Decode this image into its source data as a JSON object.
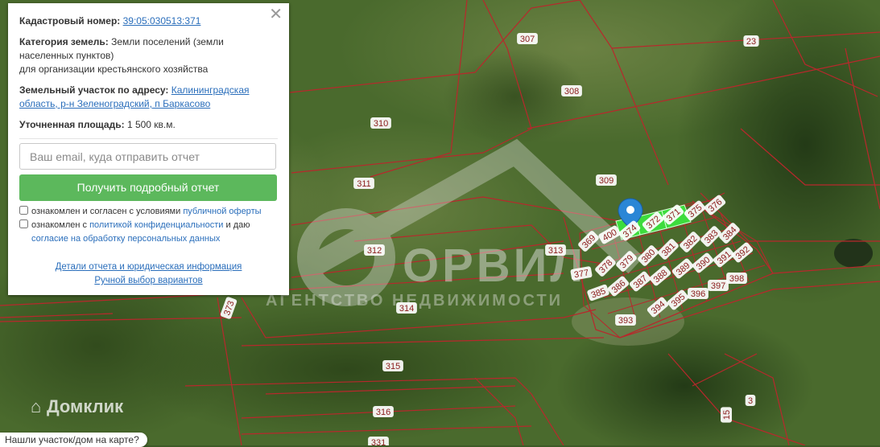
{
  "panel": {
    "cadastral_label": "Кадастровый номер:",
    "cadastral_value": "39:05:030513:371",
    "category_label": "Категория земель:",
    "category_value_1": "Земли поселений (земли",
    "category_value_2": "населенных пунктов)",
    "category_value_3": "для организации крестьянского хозяйства",
    "address_label": "Земельный участок по адресу:",
    "address_value_1": "Калининградская",
    "address_value_2": "область, р-н Зеленоградский, п Баркасово",
    "area_label": "Уточненная площадь:",
    "area_value": "1 500 кв.м.",
    "email_placeholder": "Ваш email, куда отправить отчет",
    "submit_label": "Получить подробный отчет",
    "consent1_text": "ознакомлен и согласен с условиями",
    "consent1_link": "публичной оферты",
    "consent2_text": "ознакомлен с",
    "consent2_link": "политикой конфиденциальности",
    "consent2_text_b": "и даю",
    "consent2_link_b": "согласие на обработку персональных данных",
    "details_link": "Детали отчета и юридическая информация",
    "manual_link": "Ручной выбор вариантов",
    "close_glyph": "✕"
  },
  "watermark": {
    "brand": "ОРВИЛ",
    "tagline": "АГЕНТСТВО НЕДВИЖИМОСТИ"
  },
  "logo": {
    "text": "Домклик"
  },
  "bottom_prompt": {
    "text": "Нашли участок/дом на карте?"
  },
  "colors": {
    "boundary": "#b8282c",
    "highlight": "#3ddc3d",
    "marker": "#2a86d6",
    "button": "#5cb85c"
  },
  "map_labels": [
    "307",
    "23",
    "308",
    "310",
    "311",
    "309",
    "312",
    "313",
    "314",
    "315",
    "316",
    "331",
    "373",
    "369",
    "400",
    "374",
    "372",
    "371",
    "375",
    "376",
    "377",
    "378",
    "379",
    "380",
    "381",
    "382",
    "383",
    "384",
    "385",
    "386",
    "387",
    "388",
    "389",
    "390",
    "391",
    "392",
    "393",
    "394",
    "395",
    "396",
    "397",
    "398",
    "3",
    "15"
  ]
}
